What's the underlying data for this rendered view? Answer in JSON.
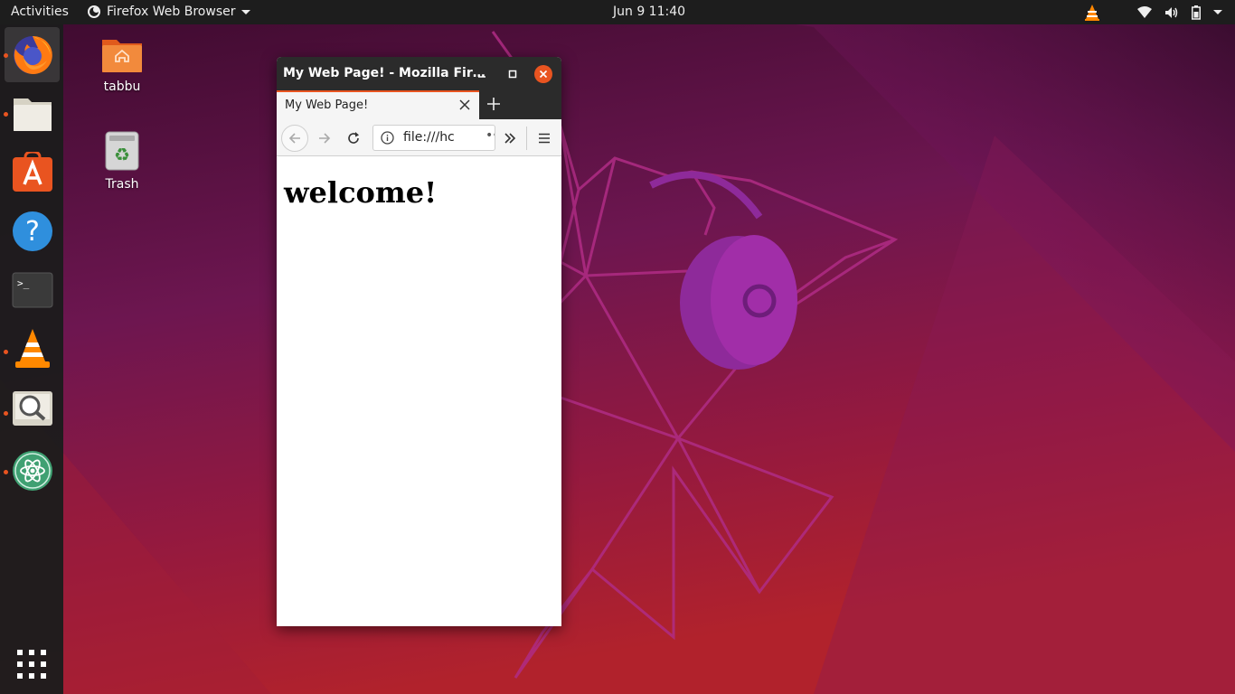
{
  "topbar": {
    "activities": "Activities",
    "app_name": "Firefox Web Browser",
    "clock": "Jun 9  11:40"
  },
  "dock": {
    "items": [
      {
        "name": "firefox",
        "icon": "firefox-icon",
        "running": true,
        "active": true
      },
      {
        "name": "files",
        "icon": "files-icon",
        "running": true
      },
      {
        "name": "software",
        "icon": "ubuntu-software-icon",
        "running": false
      },
      {
        "name": "help",
        "icon": "help-icon",
        "running": false
      },
      {
        "name": "terminal",
        "icon": "terminal-icon",
        "running": false
      },
      {
        "name": "vlc",
        "icon": "vlc-icon",
        "running": true
      },
      {
        "name": "image-viewer",
        "icon": "image-viewer-icon",
        "running": true
      },
      {
        "name": "atom",
        "icon": "atom-icon",
        "running": true
      }
    ]
  },
  "desktop": {
    "icons": [
      {
        "label": "tabbu",
        "icon": "home-folder-icon"
      },
      {
        "label": "Trash",
        "icon": "trash-icon"
      }
    ]
  },
  "window": {
    "title": "My Web Page! - Mozilla Fir…",
    "tab_label": "My Web Page!",
    "url": "file:///hc",
    "url_more": "••",
    "page_heading": "welcome!"
  },
  "colors": {
    "accent": "#e95420",
    "topbar_bg": "#1d1d1d",
    "dock_bg": "#1c1c1c",
    "titlebar_bg": "#2b2b2b"
  }
}
